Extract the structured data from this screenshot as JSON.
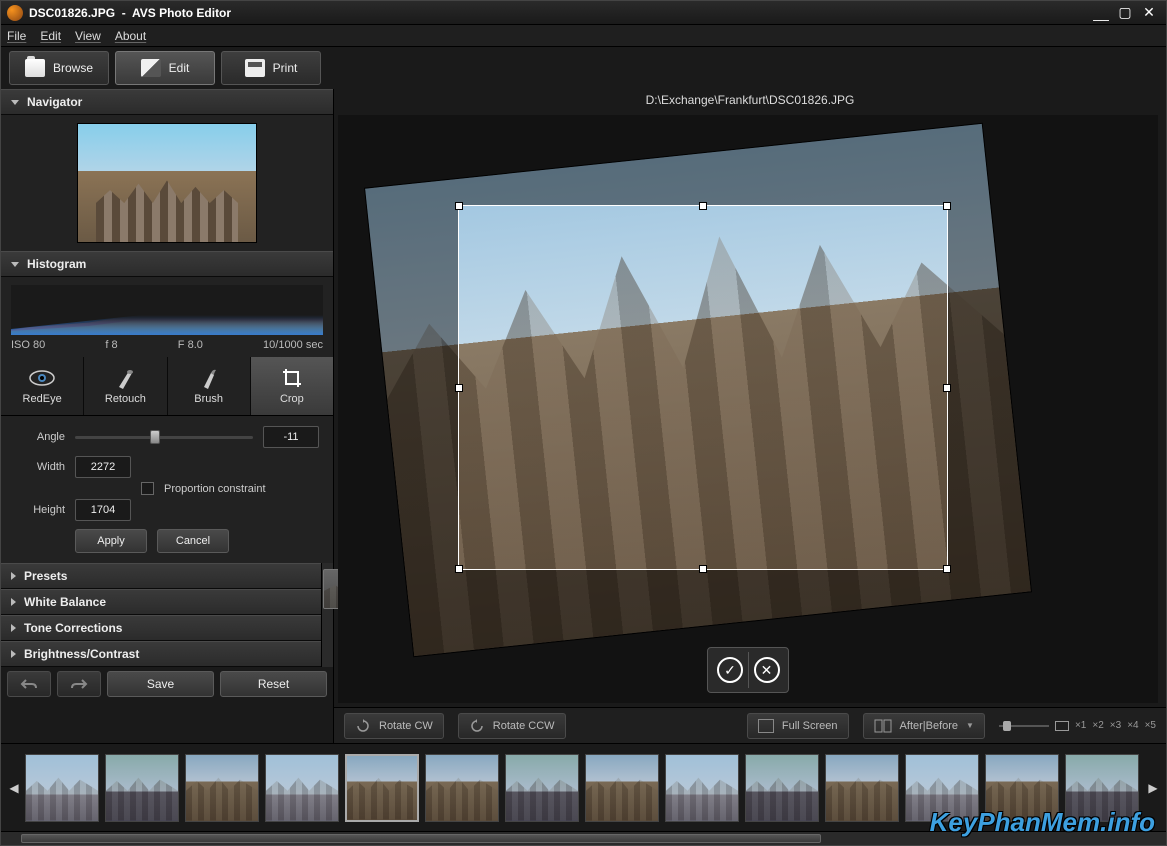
{
  "window": {
    "filename": "DSC01826.JPG",
    "app": "AVS Photo Editor"
  },
  "menu": {
    "file": "File",
    "edit": "Edit",
    "view": "View",
    "about": "About"
  },
  "toolbar": {
    "browse": "Browse",
    "edit": "Edit",
    "print": "Print"
  },
  "filepath": "D:\\Exchange\\Frankfurt\\DSC01826.JPG",
  "sidebar": {
    "navigator": "Navigator",
    "histogram": "Histogram",
    "histo_info": {
      "iso": "ISO 80",
      "aperture1": "f 8",
      "aperture2": "F 8.0",
      "shutter": "10/1000 sec"
    },
    "tools": {
      "redeye": "RedEye",
      "retouch": "Retouch",
      "brush": "Brush",
      "crop": "Crop"
    },
    "crop": {
      "angle_label": "Angle",
      "angle_value": "-11",
      "width_label": "Width",
      "width_value": "2272",
      "height_label": "Height",
      "height_value": "1704",
      "proportion": "Proportion constraint",
      "apply": "Apply",
      "cancel": "Cancel"
    },
    "panels": {
      "presets": "Presets",
      "white_balance": "White Balance",
      "tone": "Tone Corrections",
      "brightness": "Brightness/Contrast"
    },
    "save": "Save",
    "reset": "Reset"
  },
  "viewbar": {
    "rotate_cw": "Rotate CW",
    "rotate_ccw": "Rotate CCW",
    "fullscreen": "Full Screen",
    "afterbefore": "After|Before",
    "zoom": {
      "x1": "×1",
      "x2": "×2",
      "x3": "×3",
      "x4": "×4",
      "x5": "×5"
    }
  },
  "watermark": "KeyPhanMem.info"
}
